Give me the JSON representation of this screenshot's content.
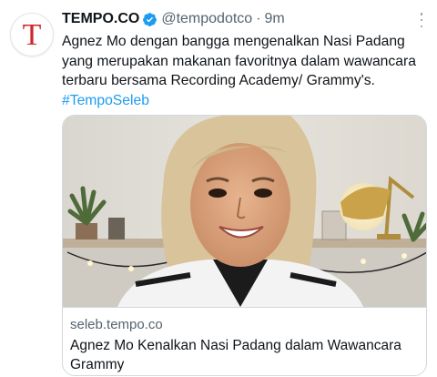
{
  "tweet": {
    "avatar_letter": "T",
    "display_name": "TEMPO.CO",
    "handle": "@tempodotco",
    "separator": "·",
    "time": "9m",
    "text": "Agnez Mo dengan bangga mengenalkan Nasi Padang yang merupakan makanan favoritnya dalam wawancara terbaru bersama Recording Academy/ Grammy's.",
    "hashtag": "#TempoSeleb",
    "more_icon": "more-horizontal-icon",
    "verified_icon": "verified-badge-icon"
  },
  "card": {
    "domain": "seleb.tempo.co",
    "title": "Agnez Mo Kenalkan Nasi Padang dalam Wawancara Grammy"
  },
  "colors": {
    "brand_red": "#d0262b",
    "link_blue": "#1d9bf0",
    "secondary_text": "#536471"
  }
}
